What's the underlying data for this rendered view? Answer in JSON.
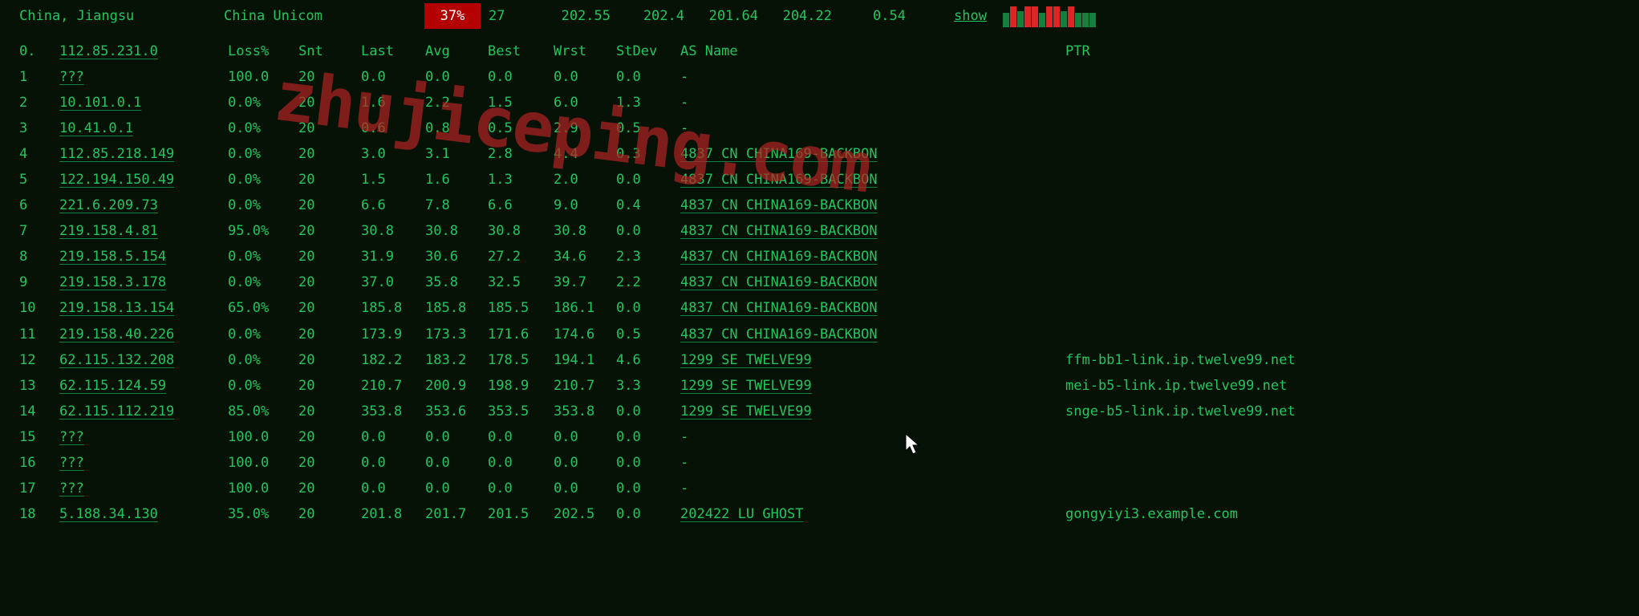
{
  "top": {
    "location": "China, Jiangsu",
    "isp": "China Unicom",
    "pct": "37%",
    "count": "27",
    "nums": [
      "202.55",
      "202.4",
      "201.64",
      "204.22",
      "0.54"
    ],
    "show": "show"
  },
  "cols": {
    "num": "0.",
    "host": "112.85.231.0",
    "loss": "Loss%",
    "snt": "Snt",
    "last": "Last",
    "avg": "Avg",
    "best": "Best",
    "wrst": "Wrst",
    "stdev": "StDev",
    "asn": "AS Name",
    "ptr": "PTR"
  },
  "rows": [
    {
      "n": "1",
      "host": "???",
      "loss": "100.0",
      "snt": "20",
      "last": "0.0",
      "avg": "0.0",
      "best": "0.0",
      "wrst": "0.0",
      "std": "0.0",
      "asn": "-",
      "ptr": ""
    },
    {
      "n": "2",
      "host": "10.101.0.1",
      "loss": "0.0%",
      "snt": "20",
      "last": "1.6",
      "avg": "2.2",
      "best": "1.5",
      "wrst": "6.0",
      "std": "1.3",
      "asn": "-",
      "ptr": ""
    },
    {
      "n": "3",
      "host": "10.41.0.1",
      "loss": "0.0%",
      "snt": "20",
      "last": "0.6",
      "avg": "0.8",
      "best": "0.5",
      "wrst": "2.9",
      "std": "0.5",
      "asn": "-",
      "ptr": ""
    },
    {
      "n": "4",
      "host": "112.85.218.149",
      "loss": "0.0%",
      "snt": "20",
      "last": "3.0",
      "avg": "3.1",
      "best": "2.8",
      "wrst": "4.4",
      "std": "0.3",
      "asn": "4837  CN CHINA169-BACKBON",
      "asnul": true,
      "ptr": ""
    },
    {
      "n": "5",
      "host": "122.194.150.49",
      "loss": "0.0%",
      "snt": "20",
      "last": "1.5",
      "avg": "1.6",
      "best": "1.3",
      "wrst": "2.0",
      "std": "0.0",
      "asn": "4837  CN CHINA169-BACKBON",
      "asnul": true,
      "ptr": ""
    },
    {
      "n": "6",
      "host": "221.6.209.73",
      "loss": "0.0%",
      "snt": "20",
      "last": "6.6",
      "avg": "7.8",
      "best": "6.6",
      "wrst": "9.0",
      "std": "0.4",
      "asn": "4837  CN CHINA169-BACKBON",
      "asnul": true,
      "ptr": ""
    },
    {
      "n": "7",
      "host": "219.158.4.81",
      "loss": "95.0%",
      "snt": "20",
      "last": "30.8",
      "avg": "30.8",
      "best": "30.8",
      "wrst": "30.8",
      "std": "0.0",
      "asn": "4837  CN CHINA169-BACKBON",
      "asnul": true,
      "ptr": ""
    },
    {
      "n": "8",
      "host": "219.158.5.154",
      "loss": "0.0%",
      "snt": "20",
      "last": "31.9",
      "avg": "30.6",
      "best": "27.2",
      "wrst": "34.6",
      "std": "2.3",
      "asn": "4837  CN CHINA169-BACKBON",
      "asnul": true,
      "ptr": ""
    },
    {
      "n": "9",
      "host": "219.158.3.178",
      "loss": "0.0%",
      "snt": "20",
      "last": "37.0",
      "avg": "35.8",
      "best": "32.5",
      "wrst": "39.7",
      "std": "2.2",
      "asn": "4837  CN CHINA169-BACKBON",
      "asnul": true,
      "ptr": ""
    },
    {
      "n": "10",
      "host": "219.158.13.154",
      "loss": "65.0%",
      "snt": "20",
      "last": "185.8",
      "avg": "185.8",
      "best": "185.5",
      "wrst": "186.1",
      "std": "0.0",
      "asn": "4837  CN CHINA169-BACKBON",
      "asnul": true,
      "ptr": ""
    },
    {
      "n": "11",
      "host": "219.158.40.226",
      "loss": "0.0%",
      "snt": "20",
      "last": "173.9",
      "avg": "173.3",
      "best": "171.6",
      "wrst": "174.6",
      "std": "0.5",
      "asn": "4837  CN CHINA169-BACKBON",
      "asnul": true,
      "ptr": ""
    },
    {
      "n": "12",
      "host": "62.115.132.208",
      "loss": "0.0%",
      "snt": "20",
      "last": "182.2",
      "avg": "183.2",
      "best": "178.5",
      "wrst": "194.1",
      "std": "4.6",
      "asn": "1299  SE TWELVE99",
      "asnul": true,
      "ptr": "ffm-bb1-link.ip.twelve99.net"
    },
    {
      "n": "13",
      "host": "62.115.124.59",
      "loss": "0.0%",
      "snt": "20",
      "last": "210.7",
      "avg": "200.9",
      "best": "198.9",
      "wrst": "210.7",
      "std": "3.3",
      "asn": "1299  SE TWELVE99",
      "asnul": true,
      "ptr": "mei-b5-link.ip.twelve99.net"
    },
    {
      "n": "14",
      "host": "62.115.112.219",
      "loss": "85.0%",
      "snt": "20",
      "last": "353.8",
      "avg": "353.6",
      "best": "353.5",
      "wrst": "353.8",
      "std": "0.0",
      "asn": "1299  SE TWELVE99",
      "asnul": true,
      "ptr": "snge-b5-link.ip.twelve99.net"
    },
    {
      "n": "15",
      "host": "???",
      "loss": "100.0",
      "snt": "20",
      "last": "0.0",
      "avg": "0.0",
      "best": "0.0",
      "wrst": "0.0",
      "std": "0.0",
      "asn": "-",
      "ptr": ""
    },
    {
      "n": "16",
      "host": "???",
      "loss": "100.0",
      "snt": "20",
      "last": "0.0",
      "avg": "0.0",
      "best": "0.0",
      "wrst": "0.0",
      "std": "0.0",
      "asn": "-",
      "ptr": ""
    },
    {
      "n": "17",
      "host": "???",
      "loss": "100.0",
      "snt": "20",
      "last": "0.0",
      "avg": "0.0",
      "best": "0.0",
      "wrst": "0.0",
      "std": "0.0",
      "asn": "-",
      "ptr": ""
    },
    {
      "n": "18",
      "host": "5.188.34.130",
      "loss": "35.0%",
      "snt": "20",
      "last": "201.8",
      "avg": "201.7",
      "best": "201.5",
      "wrst": "202.5",
      "std": "0.0",
      "asn": "202422 LU GHOST",
      "asnul": true,
      "ptr": "gongyiyi3.example.com"
    }
  ],
  "watermark": "zhujiceping.com"
}
